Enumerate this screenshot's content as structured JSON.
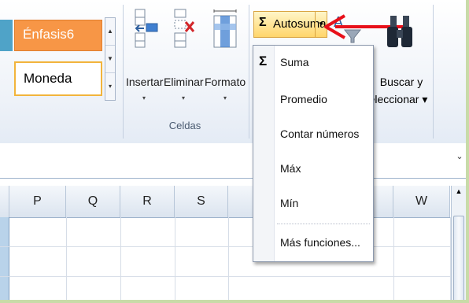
{
  "ribbon": {
    "styles": {
      "enfasis6": "Énfasis6",
      "moneda": "Moneda"
    },
    "cells_group": {
      "group_label": "Celdas",
      "insert_label": "Insertar",
      "delete_label": "Eliminar",
      "format_label": "Formato"
    },
    "editing": {
      "autosum_symbol": "Σ",
      "autosum_label": "Autosuma",
      "find_label_line1": "Buscar y",
      "find_label_line2": "eleccionar ▾"
    }
  },
  "menu": {
    "sigma": "Σ",
    "items": [
      "Suma",
      "Promedio",
      "Contar números",
      "Máx",
      "Mín",
      "Más funciones..."
    ]
  },
  "grid": {
    "columns": [
      "P",
      "Q",
      "R",
      "S",
      "W"
    ]
  },
  "colors": {
    "accent_orange": "#f79646",
    "highlight_yellow": "#ffd66b",
    "arrow_red": "#e8101a"
  }
}
